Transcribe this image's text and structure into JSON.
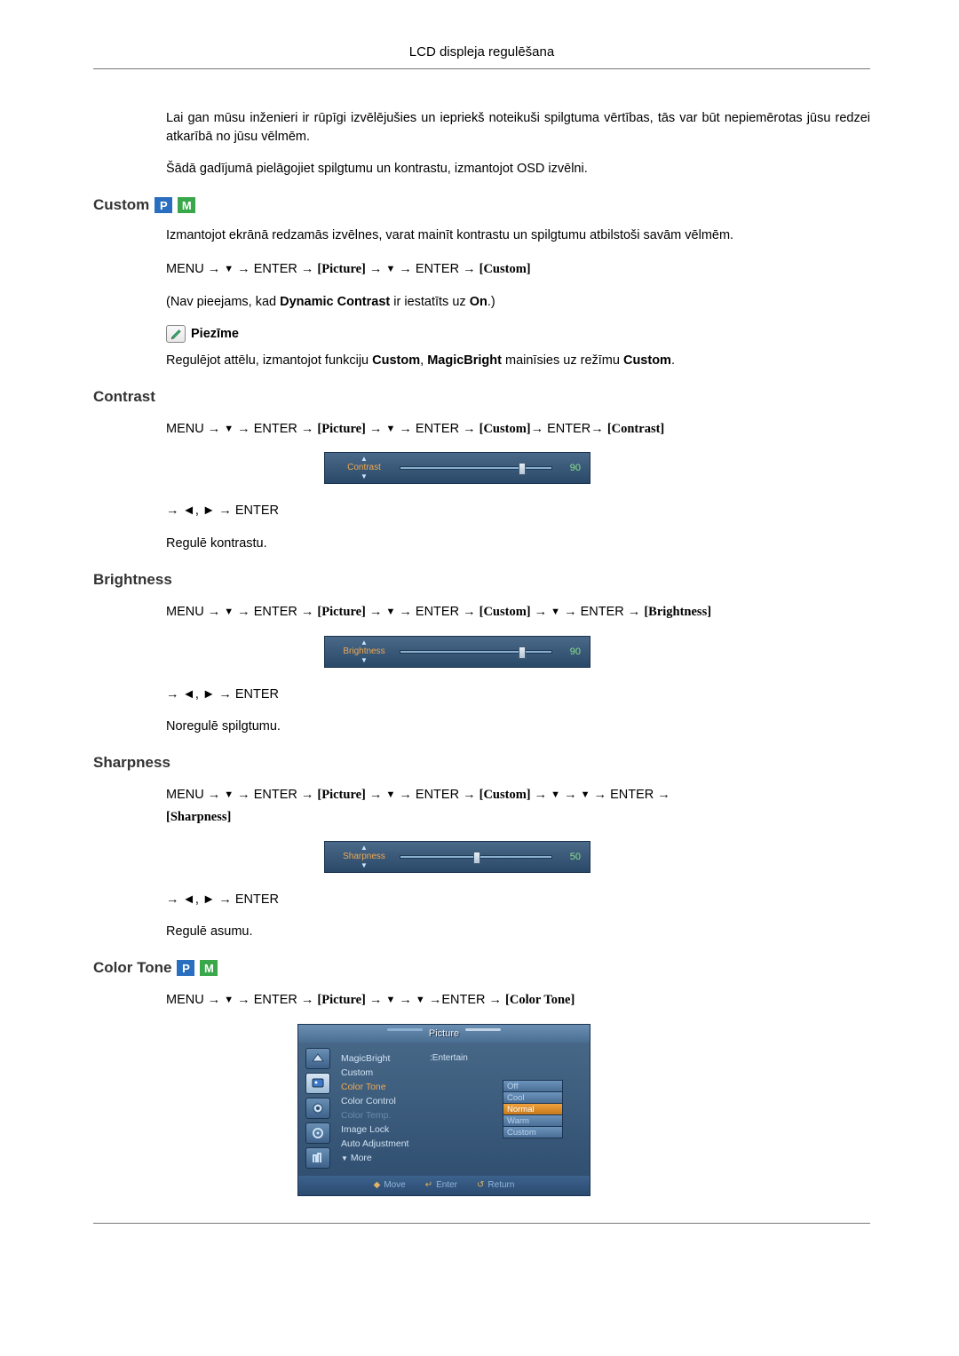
{
  "header": {
    "title": "LCD displeja regulēšana"
  },
  "intro": {
    "p1": "Lai gan mūsu inženieri ir rūpīgi izvēlējušies un iepriekš noteikuši spilgtuma vērtības, tās var būt nepiemērotas jūsu redzei atkarībā no jūsu vēlmēm.",
    "p2": "Šādā gadījumā pielāgojiet spilgtumu un kontrastu, izmantojot OSD izvēlni."
  },
  "badge": {
    "p": "P",
    "m": "M"
  },
  "custom": {
    "title": "Custom",
    "p1": "Izmantojot ekrānā redzamās izvēlnes, varat mainīt kontrastu un spilgtumu atbilstoši savām vēlmēm.",
    "nav_pre": "MENU → ",
    "nav_mid1": " → ENTER → ",
    "nav_picture": "[Picture]",
    "nav_mid2": " → ",
    "nav_mid3": " → ENTER → ",
    "nav_custom": "[Custom]",
    "p2_pre": "(Nav pieejams, kad ",
    "p2_b1": "Dynamic Contrast",
    "p2_mid": " ir iestatīts uz ",
    "p2_b2": "On",
    "p2_post": ".)",
    "note_label": "Piezīme",
    "p3_pre": "Regulējot attēlu, izmantojot funkciju ",
    "p3_b1": "Custom",
    "p3_mid1": ", ",
    "p3_b2": "MagicBright",
    "p3_mid2": " mainīsies uz režīmu ",
    "p3_b3": "Custom",
    "p3_post": "."
  },
  "contrast": {
    "title": "Contrast",
    "nav_pre": "MENU → ",
    "nav_m1": " → ENTER → ",
    "nav_picture": "[Picture]",
    "nav_m2": " → ",
    "nav_m3": " → ENTER → ",
    "nav_custom": "[Custom]",
    "nav_m4": "→ ENTER→ ",
    "nav_contrast": "[Contrast]",
    "slider_label": "Contrast",
    "slider_value": "90",
    "slider_pct": 78,
    "nav2": " → ◄, ► → ENTER",
    "p1": "Regulē kontrastu."
  },
  "brightness": {
    "title": "Brightness",
    "nav_pre": "MENU → ",
    "nav_m1": " → ENTER → ",
    "nav_picture": "[Picture]",
    "nav_m2": " → ",
    "nav_m3": " → ENTER → ",
    "nav_custom": "[Custom]",
    "nav_m4": " → ",
    "nav_m5": " → ENTER → ",
    "nav_bright": "[Brightness]",
    "slider_label": "Brightness",
    "slider_value": "90",
    "slider_pct": 78,
    "nav2": " → ◄, ► → ENTER",
    "p1": "Noregulē spilgtumu."
  },
  "sharpness": {
    "title": "Sharpness",
    "nav_pre": "MENU  →  ",
    "nav_m1": "  →  ENTER  →  ",
    "nav_picture": "[Picture]",
    "nav_m2": "  →  ",
    "nav_m3": "  →  ENTER  →  ",
    "nav_custom": "[Custom]",
    "nav_m4": "  →  ",
    "nav_m5": "  →  ",
    "nav_m6": "  →  ENTER  → ",
    "nav_sharp": "[Sharpness]",
    "slider_label": "Sharpness",
    "slider_value": "50",
    "slider_pct": 48,
    "nav2": " → ◄, ► → ENTER",
    "p1": "Regulē asumu."
  },
  "colortone": {
    "title": "Color Tone",
    "nav_pre": "MENU → ",
    "nav_m1": " → ENTER → ",
    "nav_picture": "[Picture]",
    "nav_m2": " → ",
    "nav_m3": " → ",
    "nav_m4": " →ENTER → ",
    "nav_ct": "[Color Tone]",
    "osd": {
      "title": "Picture",
      "items": [
        {
          "label": "MagicBright",
          "value": "Entertain",
          "style": "normal"
        },
        {
          "label": "Custom",
          "value": "",
          "style": "normal"
        },
        {
          "label": "Color Tone",
          "value": "",
          "style": "orange"
        },
        {
          "label": "Color Control",
          "value": "",
          "style": "normal"
        },
        {
          "label": "Color Temp.",
          "value": "",
          "style": "dim"
        },
        {
          "label": "Image Lock",
          "value": "",
          "style": "normal"
        },
        {
          "label": "Auto Adjustment",
          "value": "",
          "style": "normal"
        }
      ],
      "more": "More",
      "options": [
        {
          "label": "Off",
          "hl": false
        },
        {
          "label": "Cool",
          "hl": false
        },
        {
          "label": "Normal",
          "hl": true
        },
        {
          "label": "Warm",
          "hl": false
        },
        {
          "label": "Custom",
          "hl": false
        }
      ],
      "footer": {
        "move": "Move",
        "enter": "Enter",
        "return": "Return"
      }
    }
  }
}
